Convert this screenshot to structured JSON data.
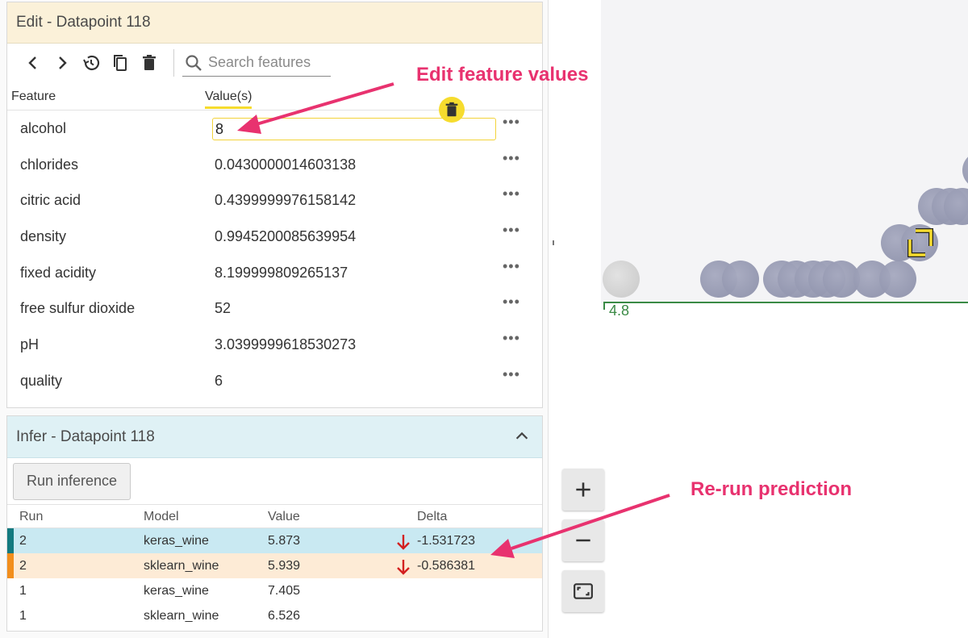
{
  "edit_panel": {
    "title": "Edit - Datapoint 118",
    "search_placeholder": "Search features",
    "col_feature": "Feature",
    "col_values": "Value(s)",
    "rows": [
      {
        "name": "alcohol",
        "value": "8"
      },
      {
        "name": "chlorides",
        "value": "0.0430000014603138"
      },
      {
        "name": "citric acid",
        "value": "0.4399999976158142"
      },
      {
        "name": "density",
        "value": "0.9945200085639954"
      },
      {
        "name": "fixed acidity",
        "value": "8.199999809265137"
      },
      {
        "name": "free sulfur dioxide",
        "value": "52"
      },
      {
        "name": "pH",
        "value": "3.0399999618530273"
      },
      {
        "name": "quality",
        "value": "6"
      }
    ],
    "more_label": "•••"
  },
  "infer_panel": {
    "title": "Infer - Datapoint 118",
    "run_button": "Run inference",
    "columns": {
      "run": "Run",
      "model": "Model",
      "value": "Value",
      "delta": "Delta"
    },
    "results": [
      {
        "run": "2",
        "model": "keras_wine",
        "value": "5.873",
        "delta": "-1.531723"
      },
      {
        "run": "2",
        "model": "sklearn_wine",
        "value": "5.939",
        "delta": "-0.586381"
      },
      {
        "run": "1",
        "model": "keras_wine",
        "value": "7.405",
        "delta": ""
      },
      {
        "run": "1",
        "model": "sklearn_wine",
        "value": "6.526",
        "delta": ""
      }
    ]
  },
  "plot": {
    "axis_label": "4.8"
  },
  "annotations": {
    "edit_callout": "Edit feature values",
    "rerun_callout": "Re-run prediction"
  },
  "colors": {
    "accent_yellow": "#f6dc2e",
    "callout_pink": "#e8326f",
    "keras_bar": "#137a7f",
    "sklearn_bar": "#f28e1c",
    "keras_row_bg": "#c9e9f2",
    "sklearn_row_bg": "#fdebd6",
    "delta_arrow": "#d32020"
  },
  "icons": [
    "chevron-left-icon",
    "chevron-right-icon",
    "history-icon",
    "copy-icon",
    "delete-icon",
    "search-icon",
    "expand-less-icon",
    "zoom-in-icon",
    "zoom-out-icon",
    "fit-screen-icon"
  ]
}
